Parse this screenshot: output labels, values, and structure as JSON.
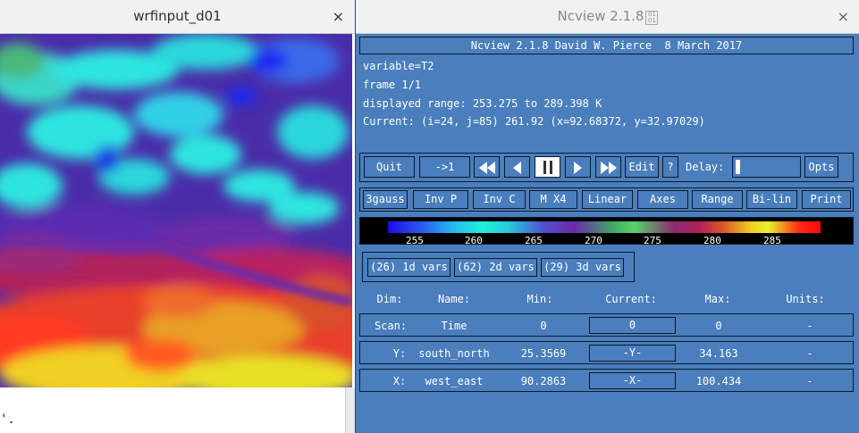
{
  "image_window": {
    "title": "wrfinput_d01",
    "close_glyph": "×",
    "stray_text": "'."
  },
  "ncview_window": {
    "title": "Ncview 2.1.8",
    "close_glyph": "×",
    "header_banner": "Ncview 2.1.8 David W. Pierce  8 March 2017",
    "info": {
      "variable": "variable=T2",
      "frame": "frame 1/1",
      "range": "displayed range: 253.275 to 289.398 K",
      "current": "Current: (i=24, j=85) 261.92 (x=92.68372, y=32.97029)"
    },
    "controls": {
      "quit": "Quit",
      "goto_one": "->1",
      "rewind_icon": "fast-rewind-icon",
      "back_icon": "step-back-icon",
      "pause_icon": "pause-icon",
      "forward_icon": "step-forward-icon",
      "ffwd_icon": "fast-forward-icon",
      "edit": "Edit",
      "help": "?",
      "delay_label": "Delay:",
      "delay_value": 0.0,
      "opts": "Opts"
    },
    "options": [
      "3gauss",
      "Inv P",
      "Inv C",
      "M X4",
      "Linear",
      "Axes",
      "Range",
      "Bi-lin",
      "Print"
    ],
    "colorbar": {
      "ticks": [
        "255",
        "260",
        "265",
        "270",
        "275",
        "280",
        "285"
      ],
      "min": 253.275,
      "max": 289.398
    },
    "var_groups": [
      "(26) 1d vars",
      "(62) 2d vars",
      "(29) 3d vars"
    ],
    "dims_table": {
      "headers": [
        "Dim:",
        "Name:",
        "Min:",
        "Current:",
        "Max:",
        "Units:"
      ],
      "rows": [
        {
          "dim": "Scan:",
          "name": "Time",
          "min": "0",
          "current": "0",
          "max": "0",
          "units": "-"
        },
        {
          "dim": "Y:",
          "name": "south_north",
          "min": "25.3569",
          "current": "-Y-",
          "max": "34.163",
          "units": "-"
        },
        {
          "dim": "X:",
          "name": "west_east",
          "min": "90.2863",
          "current": "-X-",
          "max": "100.434",
          "units": "-"
        }
      ]
    },
    "colors": {
      "panel_bg": "#4a7ebc",
      "border": "#0b1a2b",
      "text": "#ffffff"
    }
  }
}
